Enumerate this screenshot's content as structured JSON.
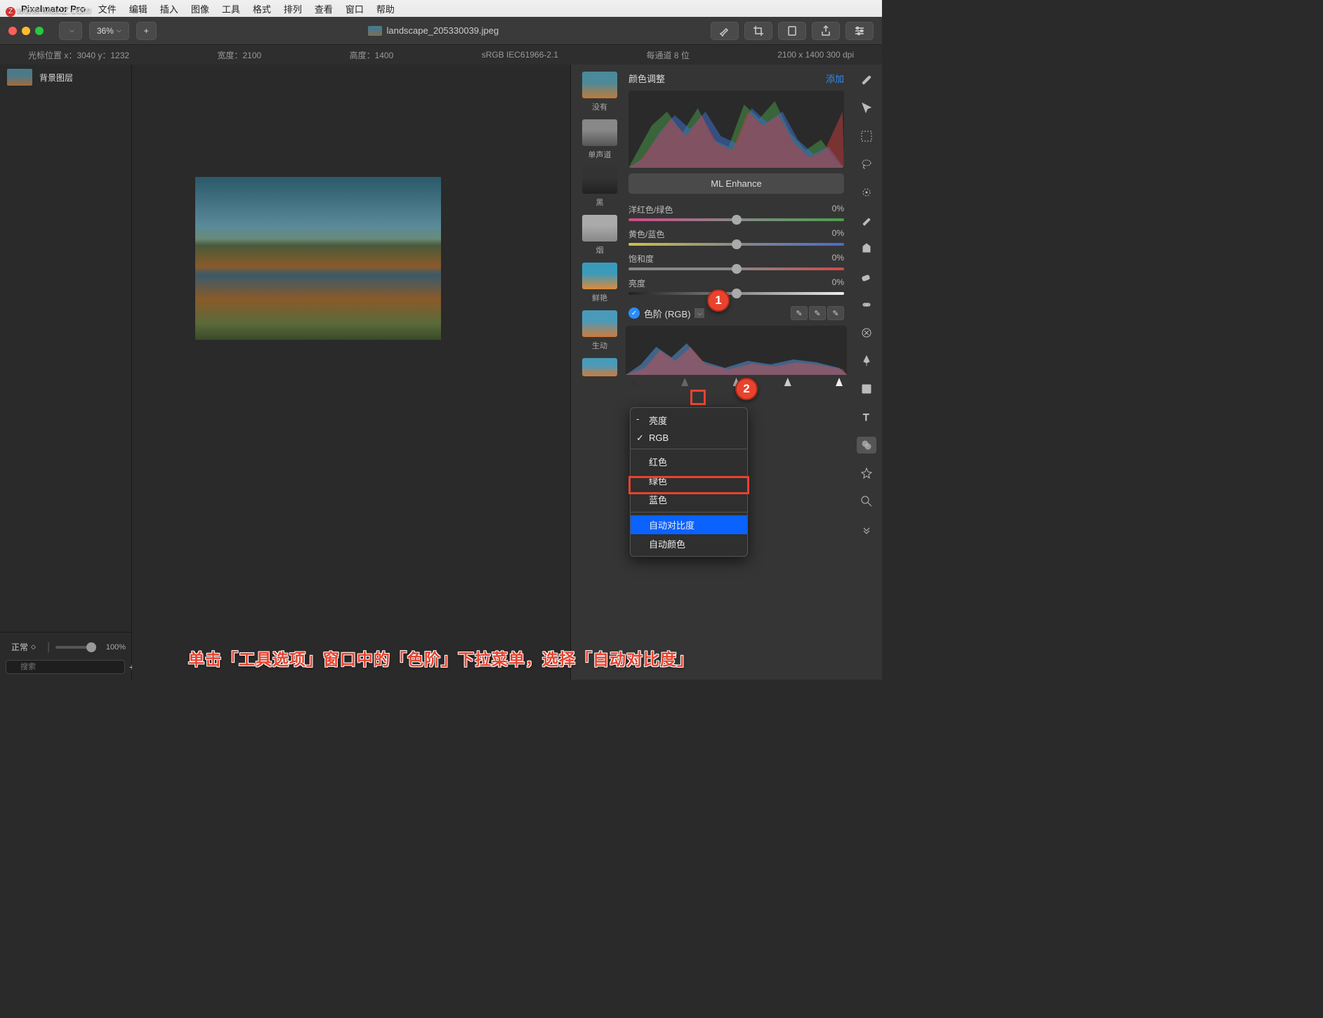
{
  "watermark": "www.MacZ.com",
  "menubar": {
    "appname": "Pixelmator Pro",
    "items": [
      "文件",
      "编辑",
      "插入",
      "图像",
      "工具",
      "格式",
      "排列",
      "查看",
      "窗口",
      "帮助"
    ]
  },
  "toolbar": {
    "zoom": "36%",
    "title": "landscape_205330039.jpeg"
  },
  "infobar": {
    "cursor": "光标位置 x：3040    y：1232",
    "width": "宽度：2100",
    "height": "高度：1400",
    "colorspace": "sRGB IEC61966-2.1",
    "depth": "每通道 8 位",
    "dims": "2100 x 1400 300 dpi"
  },
  "layers": {
    "bg": "背景图层",
    "blend": "正常",
    "opacity": "100%",
    "search_placeholder": "搜索"
  },
  "presets": [
    "没有",
    "单声道",
    "黑",
    "烟",
    "鲜艳",
    "生动"
  ],
  "adjust": {
    "title": "颜色调整",
    "add": "添加",
    "ml": "ML Enhance",
    "sliders": [
      {
        "name": "洋红色/绿色",
        "val": "0%"
      },
      {
        "name": "黄色/蓝色",
        "val": "0%"
      },
      {
        "name": "饱和度",
        "val": "0%"
      },
      {
        "name": "亮度",
        "val": "0%"
      }
    ],
    "levels_label": "色阶 (RGB)"
  },
  "dropdown": {
    "items": [
      "亮度",
      "RGB",
      "红色",
      "绿色",
      "蓝色",
      "自动对比度",
      "自动颜色"
    ],
    "checked": "RGB",
    "highlighted": "自动对比度"
  },
  "badges": {
    "b1": "1",
    "b2": "2"
  },
  "instruction": "单击「工具选项」窗口中的「色阶」下拉菜单，选择「自动对比度」"
}
